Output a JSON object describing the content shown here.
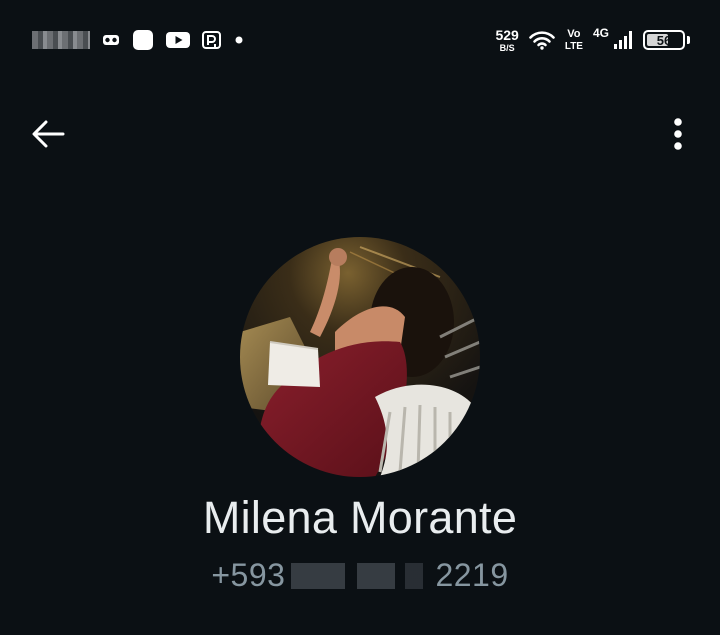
{
  "status_bar": {
    "net_speed_value": "529",
    "net_speed_unit": "B/S",
    "volte_top": "Vo",
    "volte_bottom": "LTE",
    "network_type": "4G",
    "battery_level": "56",
    "icons": [
      "vr-headset-icon",
      "app-notification-icon",
      "youtube-icon",
      "parking-app-icon",
      "notification-dot-icon",
      "wifi-icon",
      "signal-strength-icon",
      "battery-icon"
    ]
  },
  "toolbar": {
    "back_icon": "arrow-left-icon",
    "menu_icon": "more-vertical-icon"
  },
  "contact": {
    "name": "Milena Morante",
    "phone_prefix": "+593",
    "phone_suffix": "2219"
  },
  "colors": {
    "background": "#0b1014",
    "primary_text": "#e9edef",
    "secondary_text": "#8696a0"
  }
}
